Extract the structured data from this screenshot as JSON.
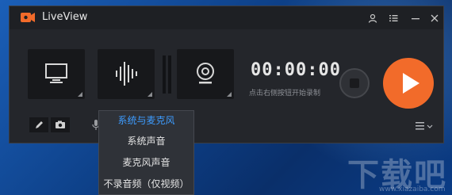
{
  "app": {
    "title": "LiveView"
  },
  "titlebar": {
    "icons": [
      "user-icon",
      "list-icon",
      "minimize-icon",
      "close-icon"
    ]
  },
  "sources": [
    {
      "name": "screen",
      "icon": "monitor-icon"
    },
    {
      "name": "audio",
      "icon": "audio-wave-icon"
    },
    {
      "name": "camera",
      "icon": "webcam-icon"
    }
  ],
  "recorder": {
    "timer": "00:00:00",
    "hint": "点击右侧按钮开始录制"
  },
  "audio_menu": {
    "items": [
      "系统与麦克风",
      "系统声音",
      "麦克风声音",
      "不录音频（仅视频）"
    ],
    "selected_index": 0
  },
  "watermark": {
    "text": "下载吧",
    "url": "www.xiazaiba.com"
  },
  "colors": {
    "accent": "#f26b2a",
    "selected": "#3d9cff",
    "window_bg": "#24262b"
  }
}
